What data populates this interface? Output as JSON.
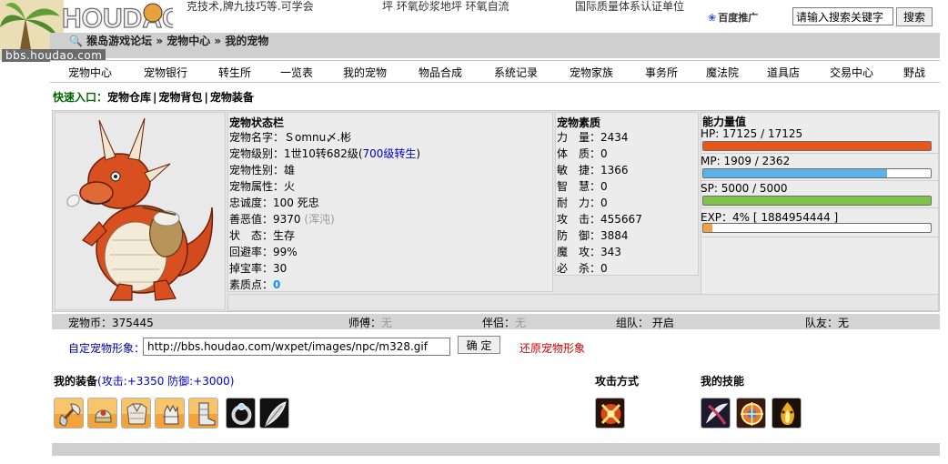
{
  "header": {
    "logo_text": "HOUDAO",
    "top_links": [
      "克技术,牌九技巧等.可学会",
      "坪 环氧砂浆地坪 环氧自流",
      "国际质量体系认证单位"
    ],
    "baidu_label": "百度推广",
    "search_placeholder": "请输入搜索关键字",
    "search_button": "搜索"
  },
  "breadcrumb": {
    "icon": "magnifier-icon",
    "text": "猴岛游戏论坛 » 宠物中心 » 我的宠物"
  },
  "watermark": "bbs.houdao.com",
  "nav": [
    "宠物中心",
    "宠物银行",
    "转生所",
    "一览表",
    "我的宠物",
    "物品合成",
    "系统记录",
    "宠物家族",
    "事务所",
    "魔法院",
    "道具店",
    "交易中心",
    "野战"
  ],
  "quick_entry": {
    "label": "快速入口：",
    "links": [
      "宠物仓库",
      "宠物背包",
      "宠物装备"
    ]
  },
  "status": {
    "title": "宠物状态栏",
    "rows": [
      {
        "label": "宠物名字：",
        "value": "Ｓomnu〆.彬"
      },
      {
        "label": "宠物级别：",
        "value": "1世10转682级(",
        "link": "700级转生",
        "suffix": ")"
      },
      {
        "label": "宠物性别：",
        "value": "雄"
      },
      {
        "label": "宠物属性：",
        "value": "火"
      },
      {
        "label": "忠诚度：",
        "value": "100 死忠"
      },
      {
        "label": "善恶值：",
        "value": "9370",
        "muted": "(浑沌)"
      },
      {
        "label": "状　态：",
        "value": "生存"
      },
      {
        "label": "回避率：",
        "value": "99%"
      },
      {
        "label": "掉宝率：",
        "value": "30"
      },
      {
        "label": "素质点：",
        "highlight": "0"
      }
    ]
  },
  "quality": {
    "title": "宠物素质",
    "rows": [
      {
        "label": "力　量：",
        "value": "2434"
      },
      {
        "label": "体　质：",
        "value": "0"
      },
      {
        "label": "敏　捷：",
        "value": "1366"
      },
      {
        "label": "智　慧：",
        "value": "0"
      },
      {
        "label": "耐　力：",
        "value": "0"
      },
      {
        "label": "攻　击：",
        "value": "455667"
      },
      {
        "label": "防　御：",
        "value": "3884"
      },
      {
        "label": "魔　攻：",
        "value": "343"
      },
      {
        "label": "必　杀：",
        "value": "0"
      }
    ]
  },
  "ability": {
    "title": "能力量值",
    "bars": [
      {
        "label": "HP:  17125 / 17125",
        "fraction": 1.0,
        "color": "#e8561a"
      },
      {
        "label": "MP:  1909 / 2362",
        "fraction": 0.808,
        "color": "#5bb2e8"
      },
      {
        "label": "SP:  5000 / 5000",
        "fraction": 1.0,
        "color": "#7ec24a"
      },
      {
        "label": "EXP：4%  [ 1884954444 ]",
        "fraction": 0.04,
        "color": "#f2a04a"
      }
    ]
  },
  "info": {
    "coins": "宠物币：375445",
    "master_label": "师傅：",
    "master_value": "无",
    "partner_label": "伴侣：",
    "partner_value": "无",
    "team_label": "组队：",
    "team_value": "开启",
    "teammate_label": "队友：",
    "teammate_value": "无"
  },
  "custom_image": {
    "label": "自定宠物形象：",
    "url": "http://bbs.houdao.com/wxpet/images/npc/m328.gif",
    "confirm": "确 定",
    "restore": "还原宠物形象"
  },
  "equipment": {
    "title": "我的装备",
    "summary": "(攻击:+3350 防御:+3000)",
    "slots": [
      "axe-icon",
      "helmet-icon",
      "armor-icon",
      "gauntlet-icon",
      "boots-icon",
      "ring-icon",
      "feather-icon"
    ]
  },
  "attack": {
    "title": "攻击方式",
    "slots": [
      "attack-skill-icon"
    ]
  },
  "skills": {
    "title": "我的技能",
    "slots": [
      "blade-skill-icon",
      "wheel-skill-icon",
      "fire-skill-icon"
    ]
  },
  "colors": {
    "nav_border": "#c4c4c4",
    "panel_bg": "#ececec",
    "quick_label": "#006600",
    "link_blue": "#0000cc",
    "restore_red": "#cc0000"
  }
}
